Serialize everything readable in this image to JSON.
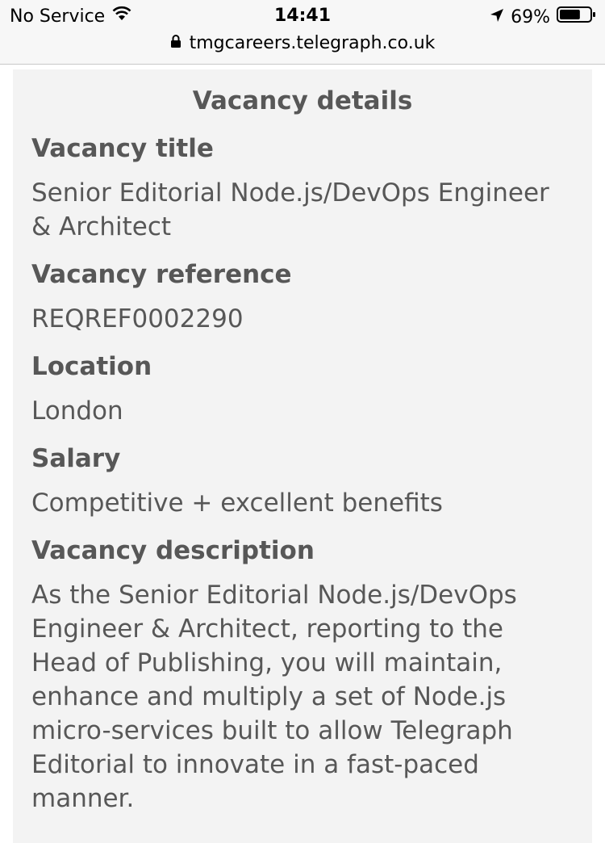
{
  "status_bar": {
    "carrier": "No Service",
    "time": "14:41",
    "battery_percent": "69%",
    "battery_level": 0.69,
    "wifi_icon": "wifi-icon",
    "location_icon": "location-arrow-icon",
    "battery_icon": "battery-icon"
  },
  "url_bar": {
    "lock_icon": "lock-icon",
    "url": "tmgcareers.telegraph.co.uk"
  },
  "panel": {
    "title": "Vacancy details",
    "fields": [
      {
        "label": "Vacancy title",
        "value": "Senior Editorial Node.js/DevOps Engineer & Architect"
      },
      {
        "label": "Vacancy reference",
        "value": "REQREF0002290"
      },
      {
        "label": "Location",
        "value": "London"
      },
      {
        "label": "Salary",
        "value": "Competitive + excellent benefits"
      },
      {
        "label": "Vacancy description",
        "value": "As the Senior Editorial Node.js/DevOps Engineer & Architect, reporting to the Head of Publishing, you will maintain, enhance and multiply a set of Node.js micro-services built to allow Telegraph Editorial to innovate in a fast-paced manner."
      }
    ]
  }
}
